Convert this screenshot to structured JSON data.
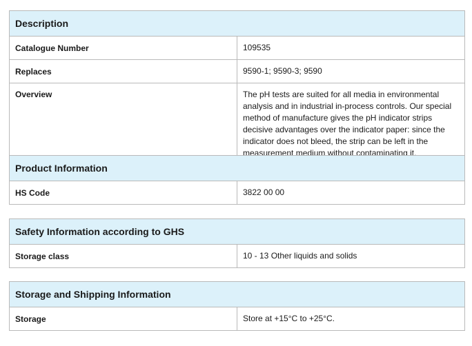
{
  "description": {
    "title": "Description",
    "rows": [
      {
        "label": "Catalogue Number",
        "value": "109535"
      },
      {
        "label": "Replaces",
        "value": "9590-1; 9590-3; 9590"
      },
      {
        "label": "Overview",
        "value": "The pH tests are suited for all media in environmental analysis and in industrial in-process controls. Our special method of manufacture gives the pH indicator strips decisive advantages over the indicator paper: since the indicator does not bleed, the strip can be left in the measurement medium without contaminating it."
      }
    ]
  },
  "product_information": {
    "title": "Product Information",
    "rows": [
      {
        "label": "HS Code",
        "value": "3822 00 00"
      }
    ]
  },
  "safety_information": {
    "title": "Safety Information according to GHS",
    "rows": [
      {
        "label": "Storage class",
        "value": "10 - 13 Other liquids and solids"
      }
    ]
  },
  "storage_shipping": {
    "title": "Storage and Shipping Information",
    "rows": [
      {
        "label": "Storage",
        "value": "Store at +15°C to +25°C."
      }
    ]
  }
}
